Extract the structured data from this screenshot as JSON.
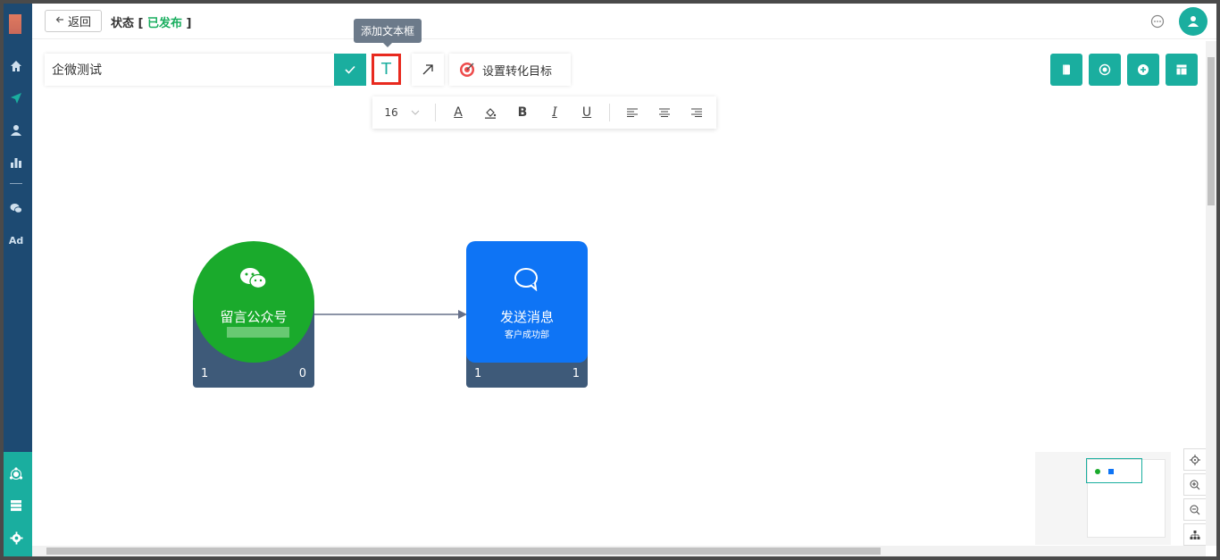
{
  "header": {
    "back_label": "返回",
    "status_label": "状态 [ ",
    "status_value": "已发布",
    "status_close": " ]"
  },
  "toolbar": {
    "name_value": "企微测试",
    "tooltip": "添加文本框",
    "text_icon_glyph": "T",
    "goal_label": "设置转化目标"
  },
  "format_bar": {
    "font_size": "16",
    "bold": "B",
    "italic": "I",
    "underline": "U",
    "font_color": "A"
  },
  "nodes": [
    {
      "title": "留言公众号",
      "subtitle": "",
      "left_count": "1",
      "right_count": "0",
      "color": "#1aaa2c"
    },
    {
      "title": "发送消息",
      "subtitle": "客户成功部",
      "left_count": "1",
      "right_count": "1",
      "color": "#0e74f5"
    }
  ],
  "colors": {
    "accent": "#1aae9f",
    "sidebar": "#1d4a72",
    "highlight": "#e82a1f"
  },
  "icons": {
    "sidebar_top": [
      "home-icon",
      "send-icon",
      "user-icon",
      "bar-chart-icon",
      "wechat-icon",
      "ad-icon"
    ],
    "sidebar_bottom": [
      "network-icon",
      "server-icon",
      "gear-icon"
    ],
    "right_tools": [
      "book-icon",
      "record-icon",
      "add-circle-icon",
      "layout-icon"
    ],
    "zoom_tools": [
      "locate-icon",
      "zoom-in-icon",
      "zoom-out-icon",
      "sitemap-icon"
    ]
  },
  "sidebar": {
    "ad_label": "Ad"
  }
}
